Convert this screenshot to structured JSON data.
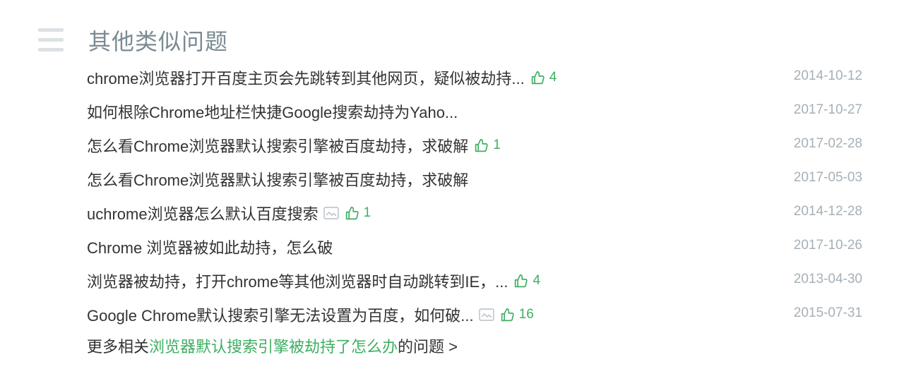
{
  "section": {
    "title": "其他类似问题"
  },
  "questions": [
    {
      "title": "chrome浏览器打开百度主页会先跳转到其他网页，疑似被劫持...",
      "has_image": false,
      "likes": "4",
      "date": "2014-10-12"
    },
    {
      "title": "如何根除Chrome地址栏快捷Google搜索劫持为Yaho...",
      "has_image": false,
      "likes": "",
      "date": "2017-10-27"
    },
    {
      "title": "怎么看Chrome浏览器默认搜索引擎被百度劫持，求破解",
      "has_image": false,
      "likes": "1",
      "date": "2017-02-28"
    },
    {
      "title": "怎么看Chrome浏览器默认搜索引擎被百度劫持，求破解",
      "has_image": false,
      "likes": "",
      "date": "2017-05-03"
    },
    {
      "title": "uchrome浏览器怎么默认百度搜索",
      "has_image": true,
      "likes": "1",
      "date": "2014-12-28"
    },
    {
      "title": "Chrome 浏览器被如此劫持，怎么破",
      "has_image": false,
      "likes": "",
      "date": "2017-10-26"
    },
    {
      "title": "浏览器被劫持，打开chrome等其他浏览器时自动跳转到IE，...",
      "has_image": false,
      "likes": "4",
      "date": "2013-04-30"
    },
    {
      "title": "Google Chrome默认搜索引擎无法设置为百度，如何破...",
      "has_image": true,
      "likes": "16",
      "date": "2015-07-31"
    }
  ],
  "more": {
    "prefix": "更多相关",
    "link": "浏览器默认搜索引擎被劫持了怎么办",
    "suffix": "的问题 >"
  },
  "colors": {
    "accent_green": "#3eaf62",
    "title_gray": "#7b8a93",
    "date_gray": "#a6b0b7",
    "text": "#333333"
  },
  "icons": {
    "menu": "menu-icon",
    "like": "thumbs-up-icon",
    "image": "image-icon"
  }
}
